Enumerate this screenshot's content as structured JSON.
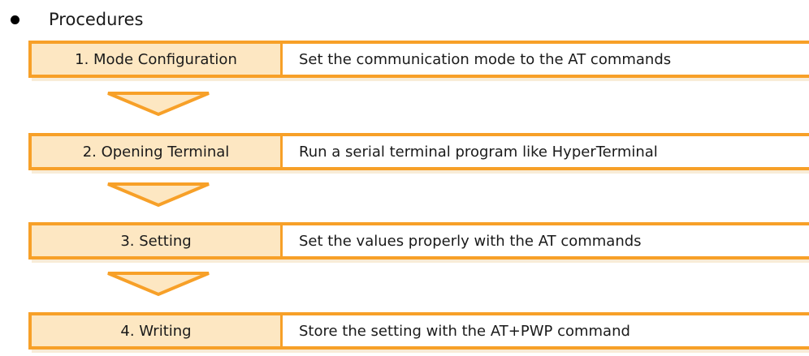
{
  "heading": "Procedures",
  "steps": [
    {
      "label": "1. Mode Configuration",
      "description": "Set the communication mode to the AT commands"
    },
    {
      "label": "2. Opening Terminal",
      "description": "Run a serial terminal program like HyperTerminal"
    },
    {
      "label": "3. Setting",
      "description": "Set the values properly with the AT commands"
    },
    {
      "label": "4. Writing",
      "description": "Store the setting with the AT+PWP command"
    }
  ],
  "colors": {
    "accent": "#f7a028",
    "label_fill": "#fde7c2",
    "arrow_fill": "#fde7c2"
  }
}
